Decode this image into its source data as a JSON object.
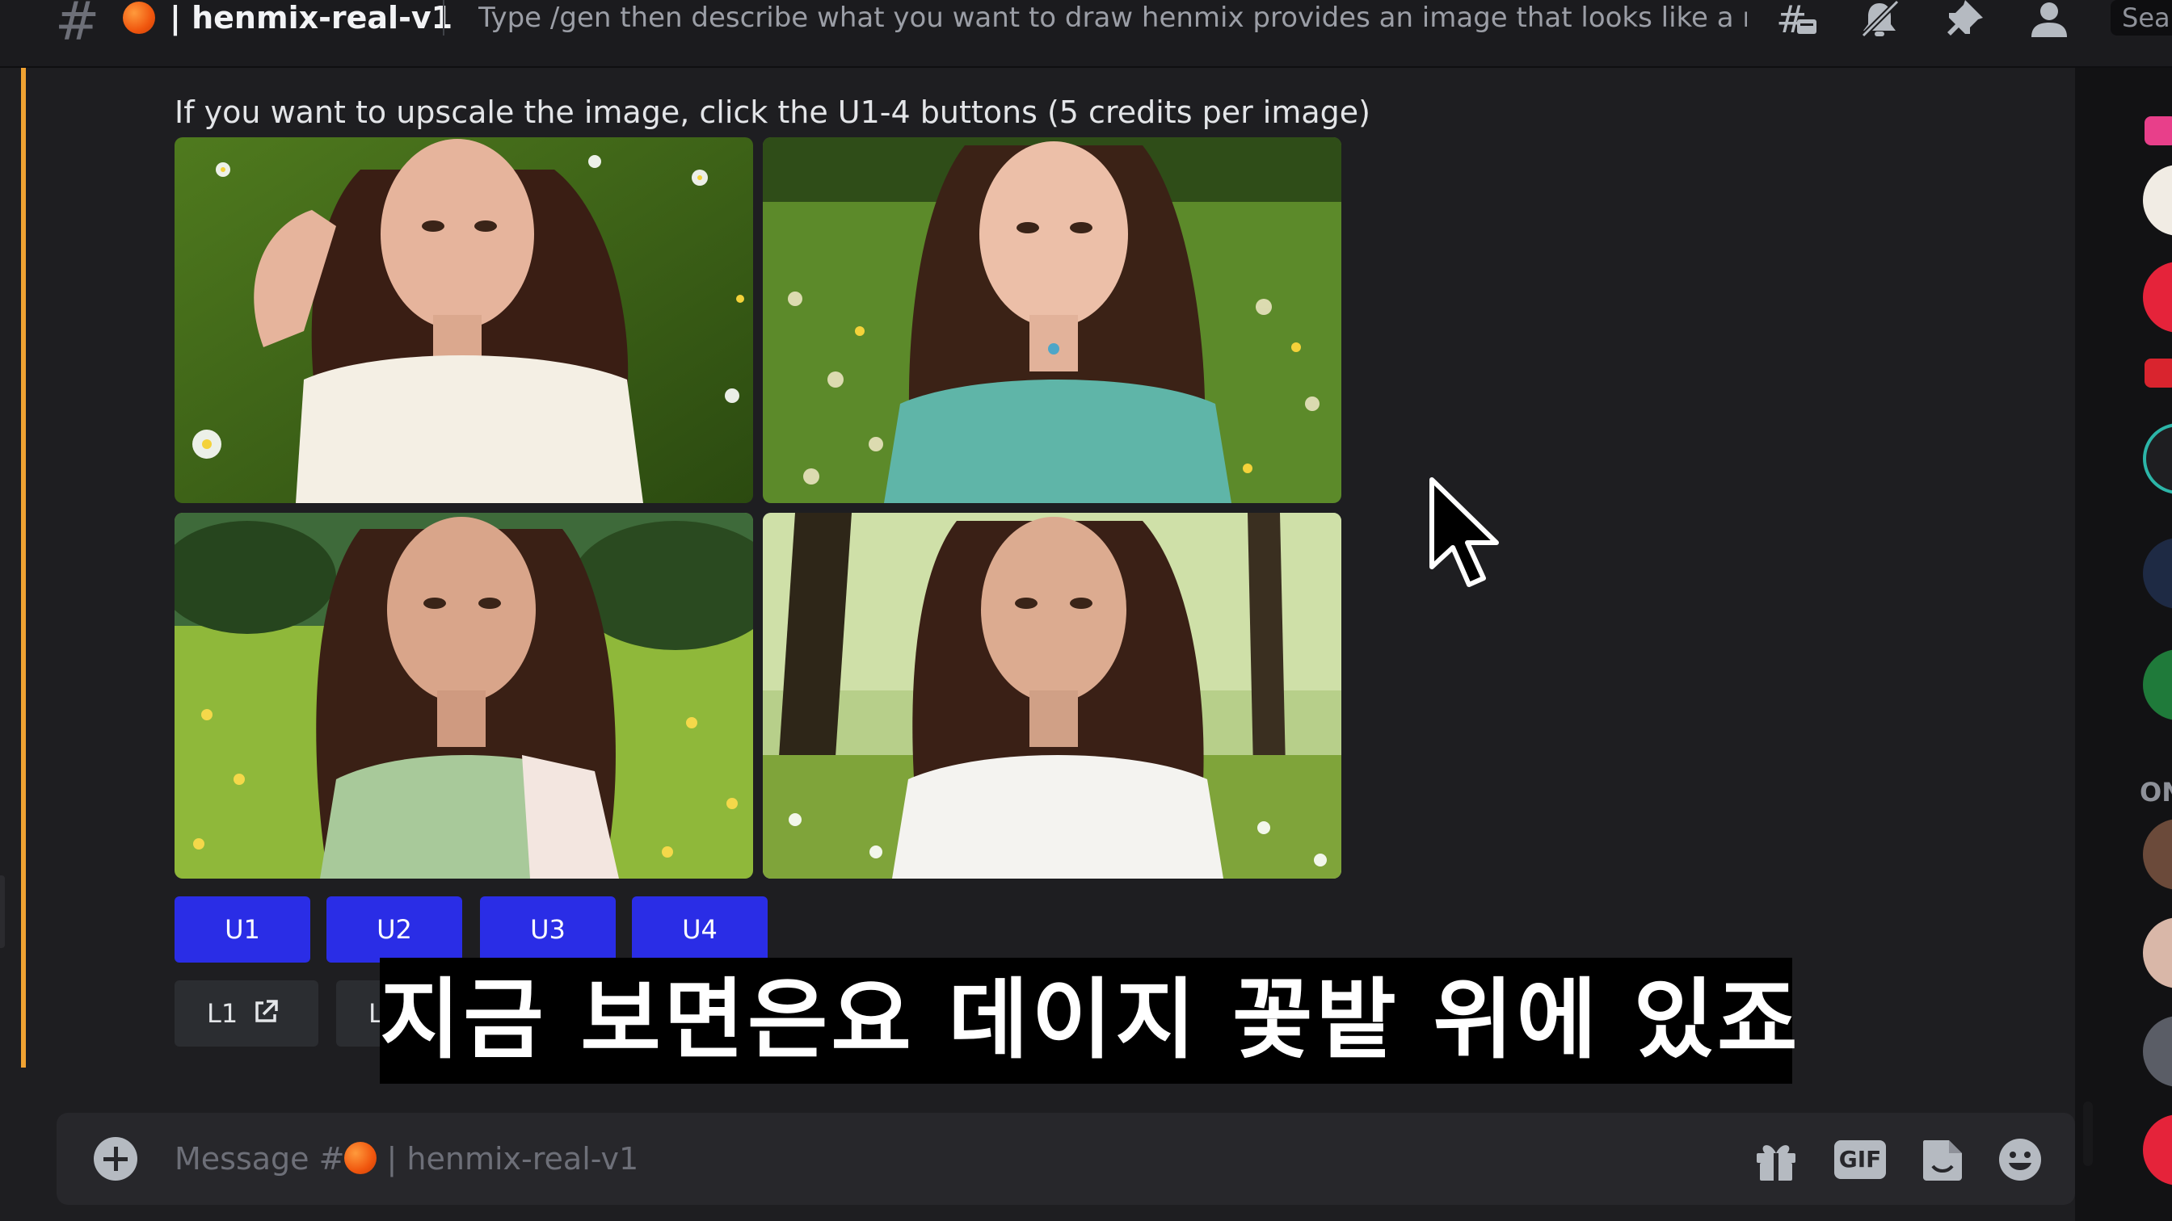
{
  "header": {
    "channel_name": "henmix-real-v1",
    "topic": "Type /gen then describe what you want to draw henmix provides an image that looks like a real ph...",
    "search_label": "Sea"
  },
  "message": {
    "instruction": "If you want to upscale the image, click the U1-4 buttons  (5 credits per image)",
    "upscale_buttons": [
      "U1",
      "U2",
      "U3",
      "U4"
    ],
    "link_buttons": [
      "L1",
      "L"
    ]
  },
  "subtitle": "지금 보면은요 데이지 꽃밭 위에 있죠",
  "composer": {
    "placeholder_prefix": "Message #",
    "placeholder_channel": " | henmix-real-v1",
    "gif_label": "GIF"
  },
  "sidebar": {
    "section_label": "ON"
  },
  "colors": {
    "upscale_button": "#2a2de6",
    "accent_bar": "#f0a232",
    "channel_emoji": "#f0560e"
  },
  "icons": [
    "hash-icon",
    "threads-icon",
    "mute-bell-icon",
    "pin-icon",
    "members-icon",
    "external-link-icon",
    "plus-icon",
    "gift-icon",
    "sticker-icon",
    "emoji-icon"
  ]
}
